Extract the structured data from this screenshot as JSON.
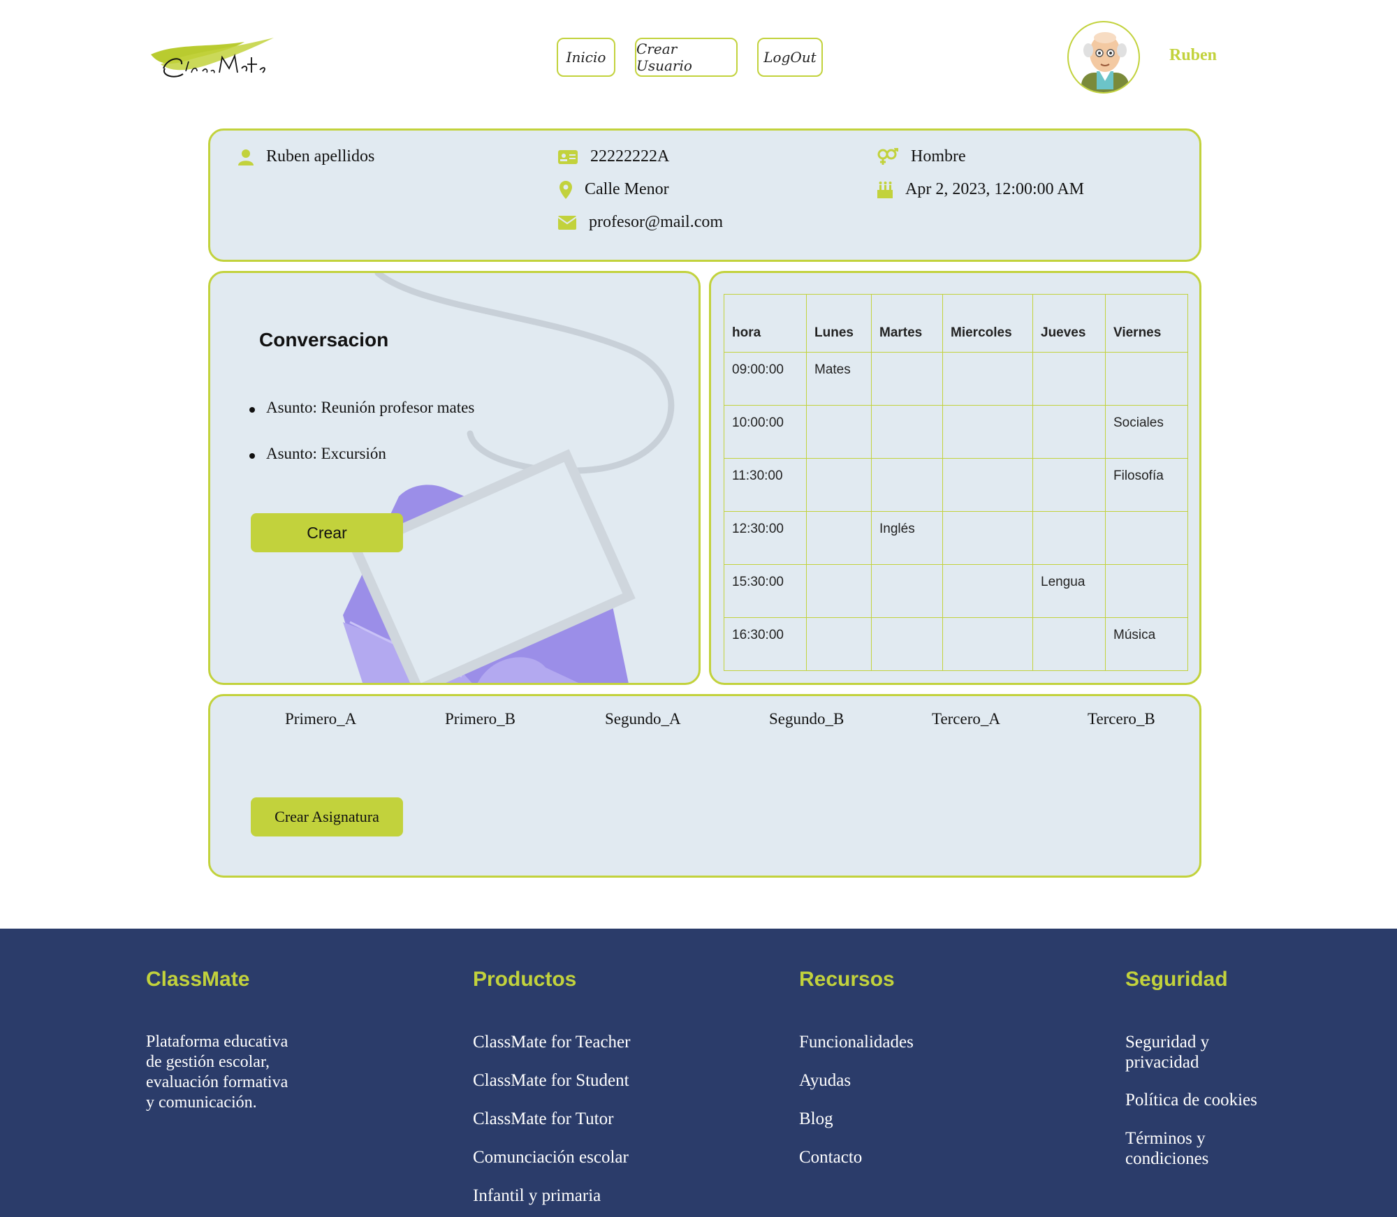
{
  "header": {
    "logo_text": "ClassMate",
    "nav": [
      "Inicio",
      "Crear Usuario",
      "LogOut"
    ],
    "username": "Ruben"
  },
  "profile": {
    "name": "Ruben apellidos",
    "dni": "22222222A",
    "address": "Calle Menor",
    "email": "profesor@mail.com",
    "gender": "Hombre",
    "birthdate": "Apr 2, 2023, 12:00:00 AM"
  },
  "conversation": {
    "title": "Conversacion",
    "items": [
      "Asunto: Reunión profesor mates",
      "Asunto: Excursión"
    ],
    "create_label": "Crear"
  },
  "timetable": {
    "headers": [
      "hora",
      "Lunes",
      "Martes",
      "Miercoles",
      "Jueves",
      "Viernes"
    ],
    "rows": [
      [
        "09:00:00",
        "Mates",
        "",
        "",
        "",
        ""
      ],
      [
        "10:00:00",
        "",
        "",
        "",
        "",
        "Sociales"
      ],
      [
        "11:30:00",
        "",
        "",
        "",
        "",
        "Filosofía"
      ],
      [
        "12:30:00",
        "",
        "Inglés",
        "",
        "",
        ""
      ],
      [
        "15:30:00",
        "",
        "",
        "",
        "Lengua",
        ""
      ],
      [
        "16:30:00",
        "",
        "",
        "",
        "",
        "Música"
      ]
    ]
  },
  "groups": {
    "items": [
      "Primero_A",
      "Primero_B",
      "Segundo_A",
      "Segundo_B",
      "Tercero_A",
      "Tercero_B"
    ],
    "create_label": "Crear Asignatura"
  },
  "footer": {
    "brand": {
      "title": "ClassMate",
      "description": [
        "Plataforma educativa",
        "de gestión escolar,",
        "evaluación formativa",
        "y comunicación."
      ]
    },
    "products": {
      "title": "Productos",
      "links": [
        "ClassMate for Teacher",
        "ClassMate for Student",
        "ClassMate for Tutor",
        "Comunciación escolar",
        "Infantil y primaria"
      ]
    },
    "resources": {
      "title": "Recursos",
      "links": [
        "Funcionalidades",
        "Ayudas",
        "Blog",
        "Contacto"
      ]
    },
    "security": {
      "title": "Seguridad",
      "links": [
        [
          "Seguridad y",
          "privacidad"
        ],
        [
          "Política de cookies"
        ],
        [
          "Términos y",
          "condiciones"
        ]
      ]
    }
  },
  "colors": {
    "accent": "#c2d23c",
    "panel_bg": "#e1eaf1",
    "footer_bg": "#2b3c6a",
    "envelope": "#9b8ee8"
  }
}
